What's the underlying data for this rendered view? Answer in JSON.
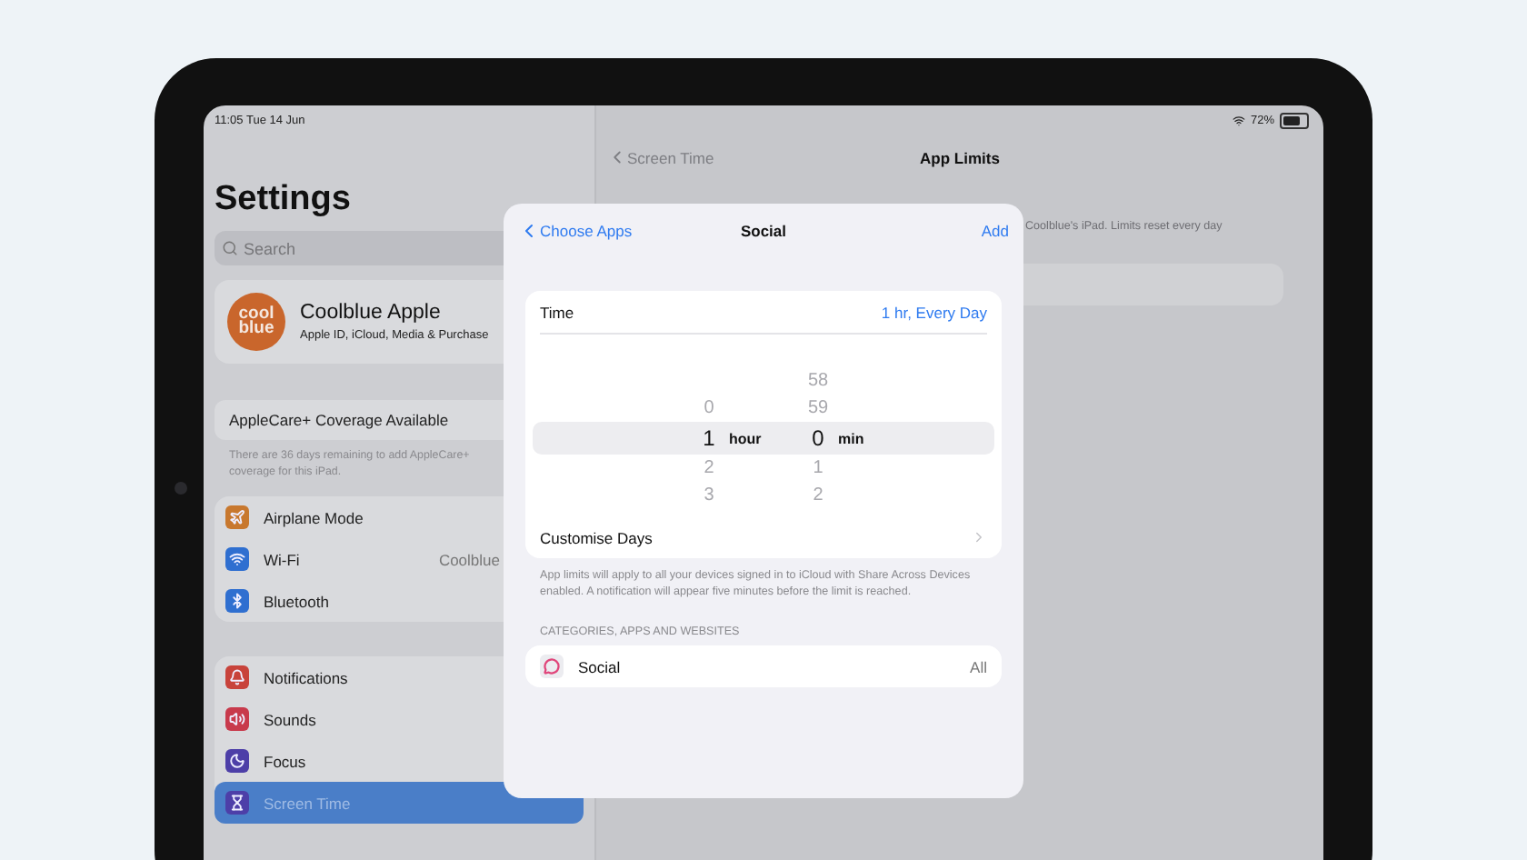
{
  "status_bar": {
    "time": "11:05  Tue 14 Jun",
    "battery": "72%"
  },
  "sidebar": {
    "title": "Settings",
    "search": {
      "placeholder": "Search"
    },
    "profile": {
      "logo_text": "cool blue",
      "name": "Coolblue Apple",
      "subtitle": "Apple ID, iCloud, Media & Purchase"
    },
    "applecare": {
      "label": "AppleCare+ Coverage Available",
      "note": "There are 36 days remaining to add AppleCare+ coverage for this iPad."
    },
    "groups": [
      [
        {
          "kind": "airplane",
          "color": "#c8782e",
          "label": "Airplane Mode",
          "selected": false
        },
        {
          "kind": "wifi",
          "color": "#2f6fd0",
          "label": "Wi-Fi",
          "value": "Coolblue",
          "selected": false
        },
        {
          "kind": "bluetooth",
          "color": "#2f6fd0",
          "label": "Bluetooth",
          "selected": false
        }
      ],
      [
        {
          "kind": "bell",
          "color": "#c8433b",
          "label": "Notifications",
          "selected": false
        },
        {
          "kind": "sound",
          "color": "#c83a4c",
          "label": "Sounds",
          "selected": false
        },
        {
          "kind": "moon",
          "color": "#4d3fa8",
          "label": "Focus",
          "selected": false
        },
        {
          "kind": "hourglass",
          "color": "#4d3fa8",
          "label": "Screen Time",
          "selected": true
        }
      ]
    ]
  },
  "detail": {
    "back": "Screen Time",
    "title": "App Limits",
    "note": "Coolblue's iPad. Limits reset every day"
  },
  "modal": {
    "back": "Choose Apps",
    "title": "Social",
    "action": "Add",
    "time": {
      "label": "Time",
      "value": "1 hr, Every Day"
    },
    "picker": [
      {
        "unit": "hour",
        "items": [
          {
            "text": "0",
            "selected": false
          },
          {
            "text": "1",
            "selected": true
          },
          {
            "text": "2",
            "selected": false
          },
          {
            "text": "3",
            "selected": false
          }
        ]
      },
      {
        "unit": "min",
        "items": [
          {
            "text": "58",
            "selected": false
          },
          {
            "text": "59",
            "selected": false
          },
          {
            "text": "0",
            "selected": true
          },
          {
            "text": "1",
            "selected": false
          },
          {
            "text": "2",
            "selected": false
          }
        ]
      }
    ],
    "customise": "Customise Days",
    "footnote": "App limits will apply to all your devices signed in to iCloud with Share Across Devices enabled. A notification will appear five minutes before the limit is reached.",
    "section": "CATEGORIES, APPS AND WEBSITES",
    "category": {
      "label": "Social",
      "value": "All"
    }
  }
}
